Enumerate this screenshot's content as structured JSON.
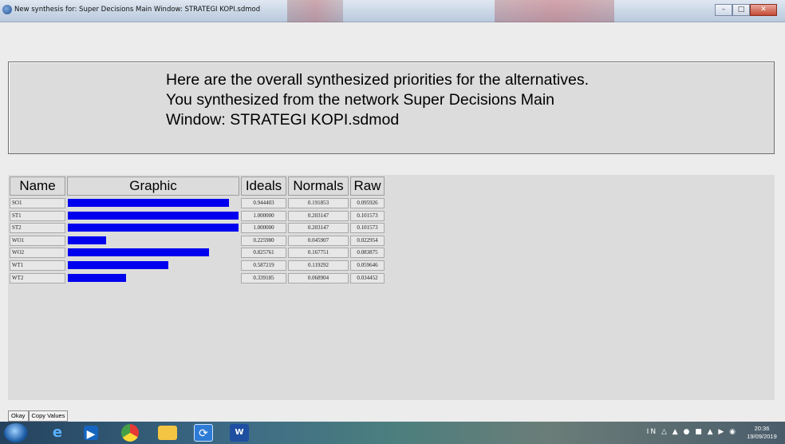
{
  "window": {
    "title": "New synthesis for: Super Decisions Main Window: STRATEGI KOPI.sdmod",
    "controls": [
      "minimize",
      "maximize",
      "close"
    ]
  },
  "message": {
    "line1": "Here are the overall synthesized priorities for the alternatives.",
    "line2": "You synthesized from the network Super Decisions Main",
    "line3": "Window: STRATEGI KOPI.sdmod"
  },
  "table": {
    "headers": {
      "name": "Name",
      "graphic": "Graphic",
      "ideals": "Ideals",
      "normals": "Normals",
      "raw": "Raw"
    },
    "bar_color": "#0000ee",
    "rows": [
      {
        "name": "SO1",
        "ideal": 0.944403,
        "ideals": "0.944403",
        "normals": "0.191853",
        "raw": "0.095926"
      },
      {
        "name": "ST1",
        "ideal": 1.0,
        "ideals": "1.000000",
        "normals": "0.203147",
        "raw": "0.101573"
      },
      {
        "name": "ST2",
        "ideal": 1.0,
        "ideals": "1.000000",
        "normals": "0.203147",
        "raw": "0.101573"
      },
      {
        "name": "WO1",
        "ideal": 0.22598,
        "ideals": "0.225980",
        "normals": "0.045907",
        "raw": "0.022954"
      },
      {
        "name": "WO2",
        "ideal": 0.825761,
        "ideals": "0.825761",
        "normals": "0.167751",
        "raw": "0.083875"
      },
      {
        "name": "WT1",
        "ideal": 0.587219,
        "ideals": "0.587219",
        "normals": "0.119292",
        "raw": "0.059646"
      },
      {
        "name": "WT2",
        "ideal": 0.339185,
        "ideals": "0.339185",
        "normals": "0.068904",
        "raw": "0.034452"
      }
    ]
  },
  "buttons": {
    "okay": "Okay",
    "copy_values": "Copy Values"
  },
  "taskbar": {
    "icons": [
      "start-orb-icon",
      "internet-explorer-icon",
      "media-player-icon",
      "chrome-icon",
      "file-explorer-icon",
      "super-decisions-icon",
      "word-icon"
    ],
    "language": "IN",
    "time": "20:36",
    "date": "19/09/2019"
  }
}
